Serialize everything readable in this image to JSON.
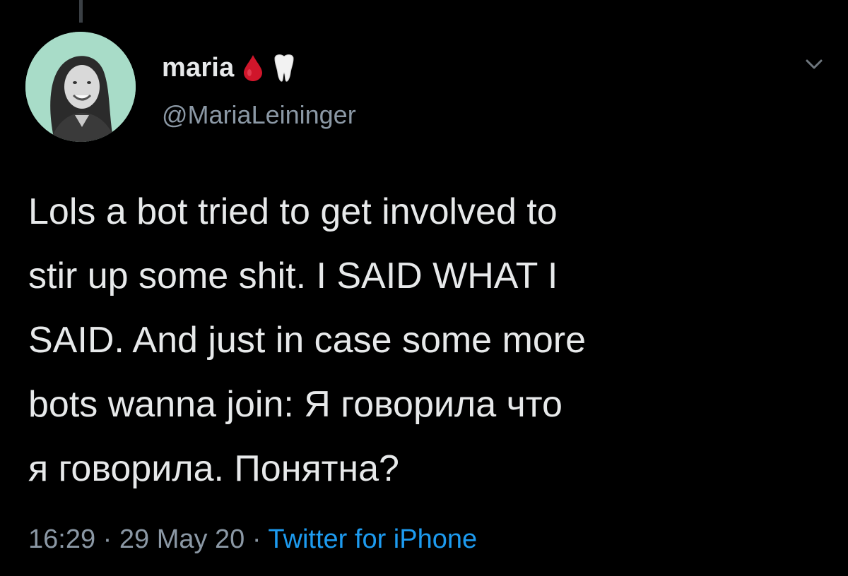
{
  "tweet": {
    "display_name": "maria",
    "name_emojis": [
      "blood-drop-icon",
      "tooth-icon"
    ],
    "handle": "@MariaLeininger",
    "text": "Lols a bot tried to get involved to\nstir up some shit. I SAID WHAT I\nSAID. And just in case some more\nbots wanna join: Я говорила что\nя говорила. Понятна?",
    "time": "16:29",
    "separator": " · ",
    "date": "29 May 20",
    "source": "Twitter for iPhone"
  },
  "colors": {
    "background": "#000000",
    "text": "#e7e9ea",
    "secondary": "#8b98a5",
    "link": "#1d9bf0",
    "avatar_bg": "#a8dcc8"
  }
}
